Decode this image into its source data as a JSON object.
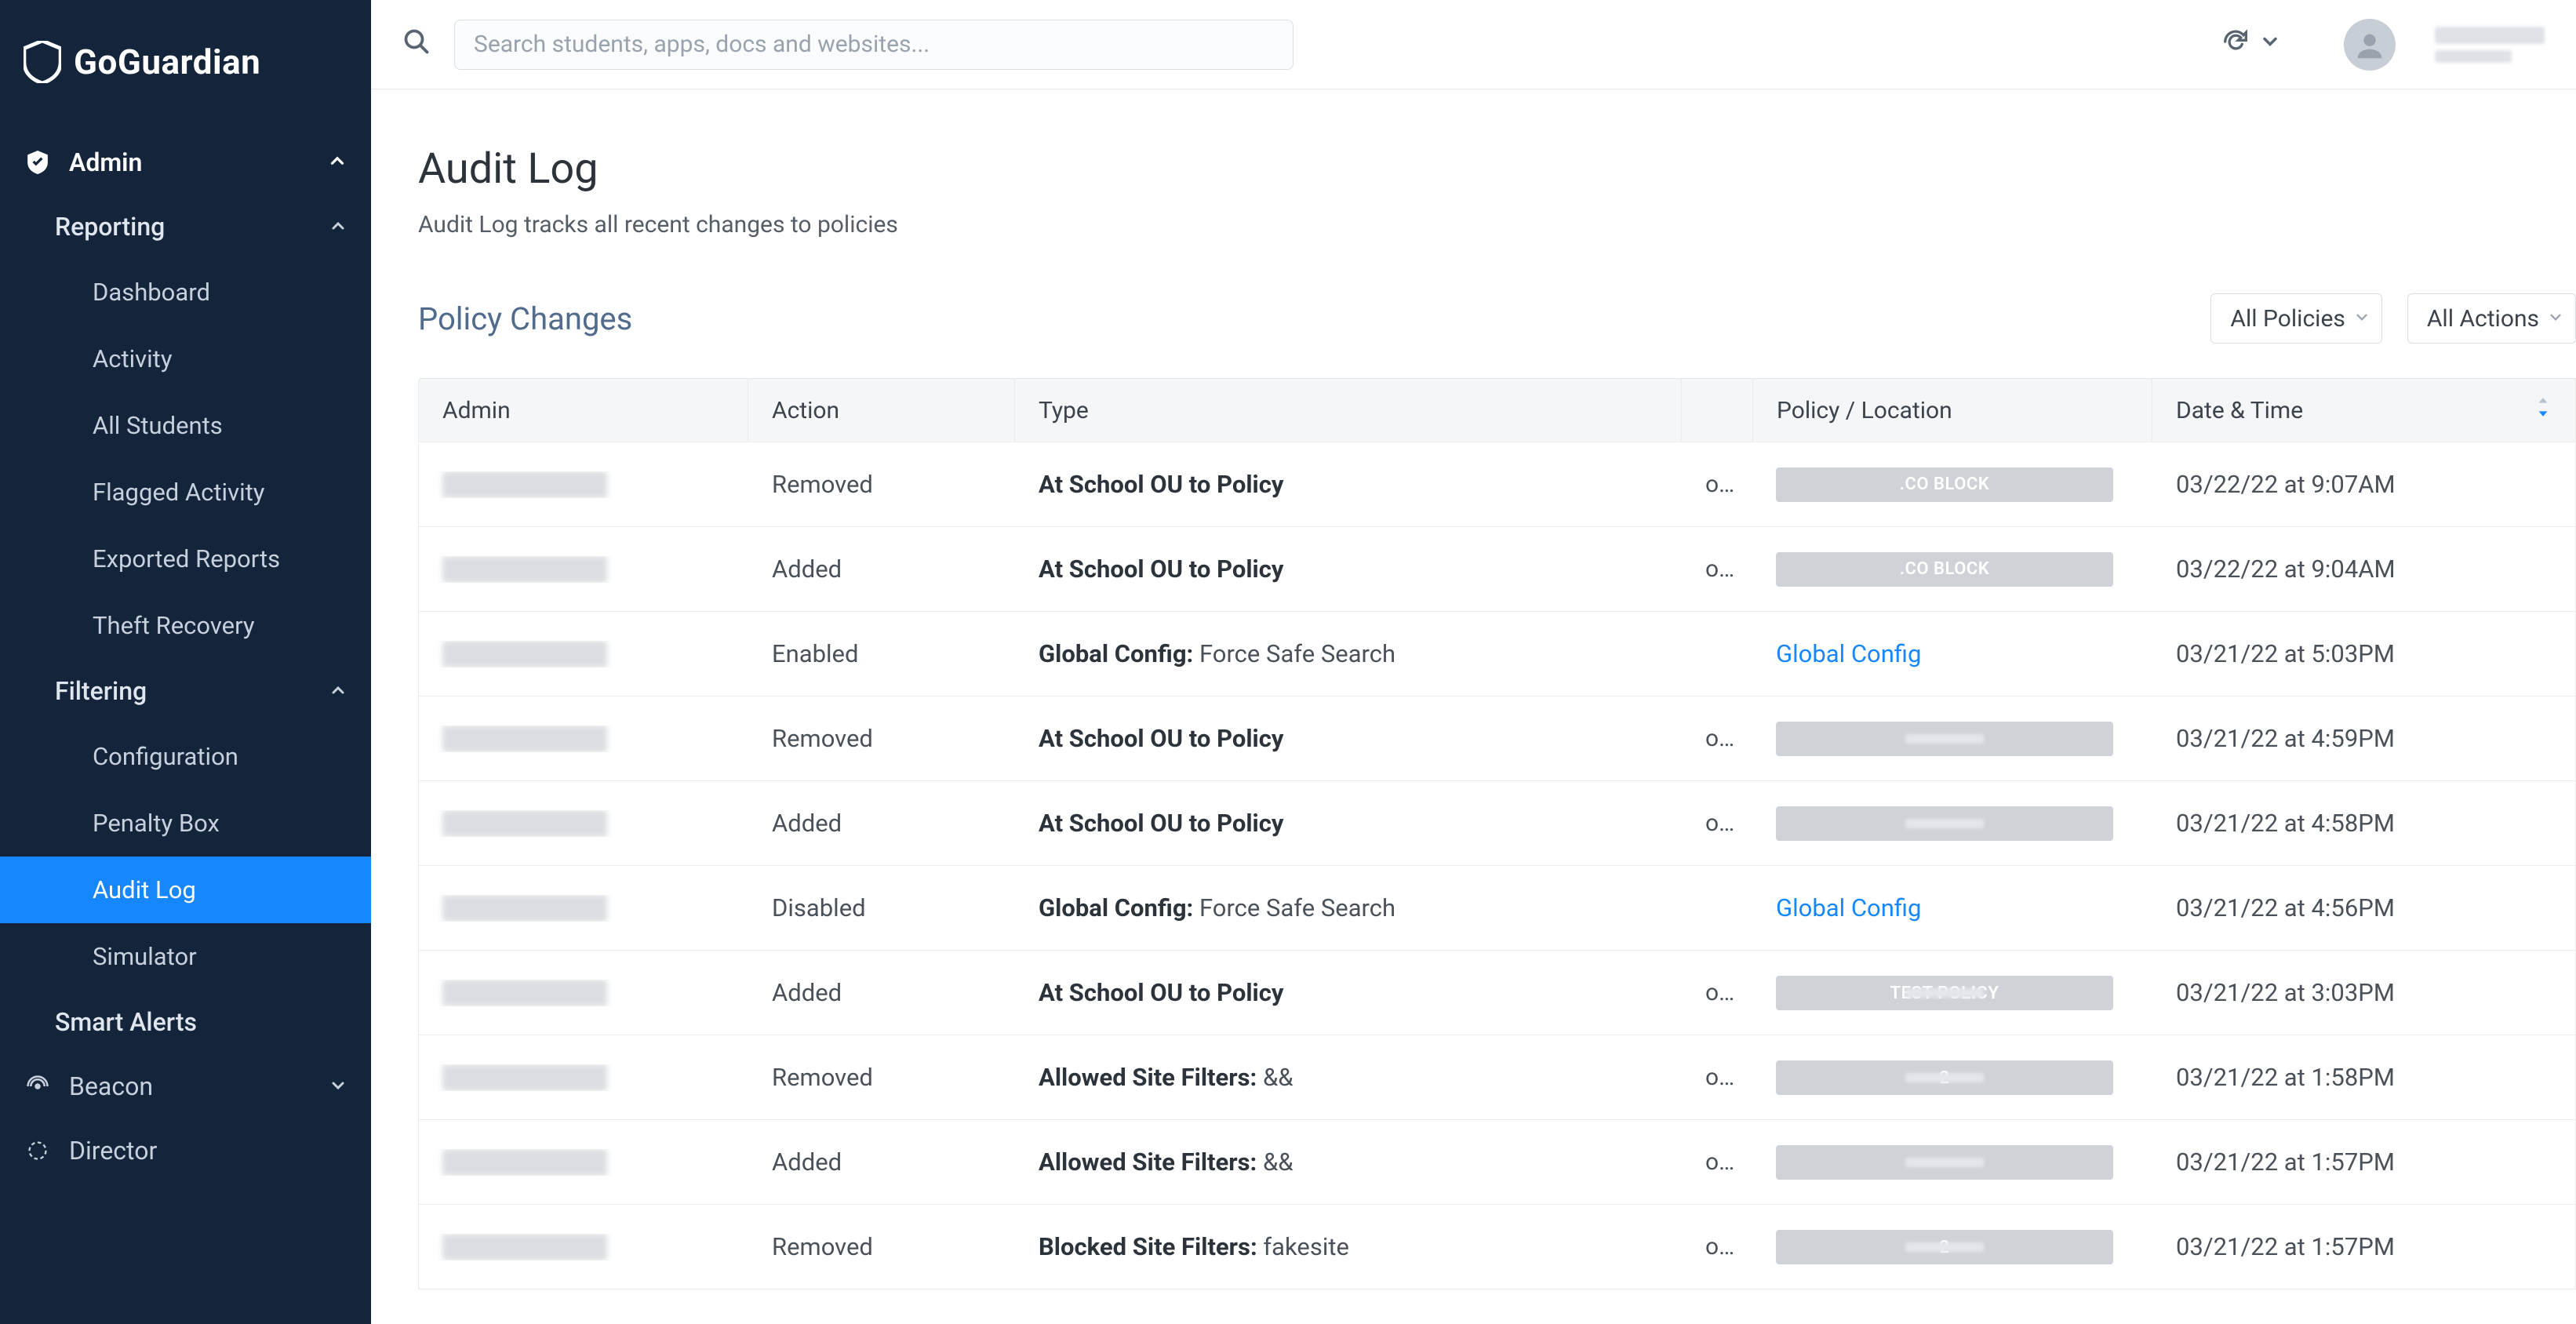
{
  "brand": {
    "name": "GoGuardian"
  },
  "search": {
    "placeholder": "Search students, apps, docs and websites..."
  },
  "user": {
    "name_redacted": true
  },
  "sidebar": {
    "admin": {
      "label": "Admin"
    },
    "reporting": {
      "label": "Reporting",
      "items": [
        "Dashboard",
        "Activity",
        "All Students",
        "Flagged Activity",
        "Exported Reports",
        "Theft Recovery"
      ]
    },
    "filtering": {
      "label": "Filtering",
      "items": [
        "Configuration",
        "Penalty Box",
        "Audit Log",
        "Simulator"
      ],
      "active_index": 2
    },
    "smart_alerts": {
      "label": "Smart Alerts"
    },
    "beacon": {
      "label": "Beacon"
    },
    "director": {
      "label": "Director"
    }
  },
  "page": {
    "title": "Audit Log",
    "subtitle": "Audit Log tracks all recent changes to policies",
    "section": "Policy Changes"
  },
  "filters": {
    "policy": "All Policies",
    "action": "All Actions"
  },
  "table": {
    "headers": [
      "Admin",
      "Action",
      "Type",
      "",
      "Policy / Location",
      "Date & Time"
    ],
    "rows": [
      {
        "admin": "[redacted]",
        "action": "Removed",
        "type_b": "At School OU to Policy",
        "type_rest": "",
        "on": "on",
        "policy": ".CO BLOCK",
        "policy_style": "pill",
        "dt": "03/22/22 at 9:07AM"
      },
      {
        "admin": "[redacted]",
        "action": "Added",
        "type_b": "At School OU to Policy",
        "type_rest": "",
        "on": "on",
        "policy": ".CO BLOCK",
        "policy_style": "pill",
        "dt": "03/22/22 at 9:04AM"
      },
      {
        "admin": "[redacted]",
        "action": "Enabled",
        "type_b": "Global Config:",
        "type_rest": " Force Safe Search",
        "on": "",
        "policy": "Global Config",
        "policy_style": "link",
        "dt": "03/21/22 at 5:03PM"
      },
      {
        "admin": "[redacted]",
        "action": "Removed",
        "type_b": "At School OU to Policy",
        "type_rest": "",
        "on": "on",
        "policy": "[redacted]",
        "policy_style": "pill-blank",
        "dt": "03/21/22 at 4:59PM"
      },
      {
        "admin": "[redacted]",
        "action": "Added",
        "type_b": "At School OU to Policy",
        "type_rest": "",
        "on": "on",
        "policy": "[redacted]",
        "policy_style": "pill-blank",
        "dt": "03/21/22 at 4:58PM"
      },
      {
        "admin": "[redacted]",
        "action": "Disabled",
        "type_b": "Global Config:",
        "type_rest": " Force Safe Search",
        "on": "",
        "policy": "Global Config",
        "policy_style": "link",
        "dt": "03/21/22 at 4:56PM"
      },
      {
        "admin": "[redacted]",
        "action": "Added",
        "type_b": "At School OU to Policy",
        "type_rest": "",
        "on": "on",
        "policy": "TEST POLICY",
        "policy_style": "pill-blank-label",
        "dt": "03/21/22 at 3:03PM"
      },
      {
        "admin": "[redacted]",
        "action": "Removed",
        "type_b": "Allowed Site Filters:",
        "type_rest": " &&",
        "on": "on",
        "policy": "2",
        "policy_style": "pill-blank-label",
        "dt": "03/21/22 at 1:58PM"
      },
      {
        "admin": "[redacted]",
        "action": "Added",
        "type_b": "Allowed Site Filters:",
        "type_rest": " &&",
        "on": "on",
        "policy": "[redacted]",
        "policy_style": "pill-blank",
        "dt": "03/21/22 at 1:57PM"
      },
      {
        "admin": "[redacted]",
        "action": "Removed",
        "type_b": "Blocked Site Filters:",
        "type_rest": " fakesite",
        "on": "on",
        "policy": "2",
        "policy_style": "pill-blank-label",
        "dt": "03/21/22 at 1:57PM"
      }
    ]
  }
}
